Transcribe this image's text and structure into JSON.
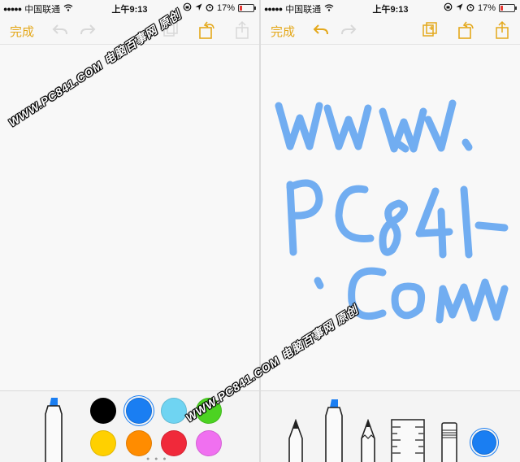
{
  "status_bar": {
    "carrier": "中国联通",
    "time": "上午9:13",
    "battery": "17%",
    "battery_fraction": 0.17
  },
  "toolbar": {
    "done_label": "完成",
    "accent_color": "#e4a81b"
  },
  "watermark": {
    "text": "WWW.PC841.COM 电脑百事网 原创"
  },
  "palette": {
    "colors": [
      "#000000",
      "#1a7ef2",
      "#6fd4f2",
      "#4cd322",
      "#ffd000",
      "#ff8c00",
      "#f0293a",
      "#f070f0"
    ],
    "selected": "#1a7ef2"
  },
  "drawing": {
    "ink_color": "#5aa0f0",
    "handwriting_lines": [
      "www.",
      "PC841",
      ".com"
    ]
  }
}
